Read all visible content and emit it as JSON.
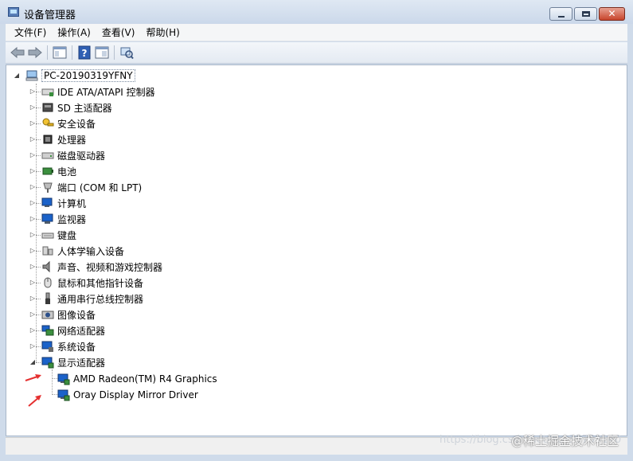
{
  "window": {
    "title": "设备管理器",
    "close_glyph": "✕"
  },
  "menu": [
    {
      "label": "文件(F)"
    },
    {
      "label": "操作(A)"
    },
    {
      "label": "查看(V)"
    },
    {
      "label": "帮助(H)"
    }
  ],
  "toolbar": {
    "icons": [
      "back-arrow-icon",
      "forward-arrow-icon",
      "properties-panel-icon",
      "help-icon",
      "show-hide-icon",
      "scan-hardware-icon"
    ]
  },
  "tree": {
    "root": {
      "label": "PC-20190319YFNY",
      "expanded": true
    },
    "categories": [
      {
        "label": "IDE ATA/ATAPI 控制器",
        "icon": "ide-controller-icon"
      },
      {
        "label": "SD 主适配器",
        "icon": "sd-adapter-icon"
      },
      {
        "label": "安全设备",
        "icon": "security-key-icon"
      },
      {
        "label": "处理器",
        "icon": "processor-icon"
      },
      {
        "label": "磁盘驱动器",
        "icon": "disk-drive-icon"
      },
      {
        "label": "电池",
        "icon": "battery-icon"
      },
      {
        "label": "端口 (COM 和 LPT)",
        "icon": "port-icon"
      },
      {
        "label": "计算机",
        "icon": "computer-icon"
      },
      {
        "label": "监视器",
        "icon": "monitor-icon"
      },
      {
        "label": "键盘",
        "icon": "keyboard-icon"
      },
      {
        "label": "人体学输入设备",
        "icon": "hid-icon"
      },
      {
        "label": "声音、视频和游戏控制器",
        "icon": "speaker-icon"
      },
      {
        "label": "鼠标和其他指针设备",
        "icon": "mouse-icon"
      },
      {
        "label": "通用串行总线控制器",
        "icon": "usb-icon"
      },
      {
        "label": "图像设备",
        "icon": "camera-icon"
      },
      {
        "label": "网络适配器",
        "icon": "network-adapter-icon"
      },
      {
        "label": "系统设备",
        "icon": "system-device-icon"
      },
      {
        "label": "显示适配器",
        "icon": "display-adapter-icon",
        "expanded": true
      }
    ],
    "display_children": [
      {
        "label": "AMD Radeon(TM) R4 Graphics"
      },
      {
        "label": "Oray Display Mirror Driver"
      }
    ]
  },
  "watermark": {
    "url": "https://blog.csdn.net/qq_35753140",
    "brand": "@稀土掘金技术社区"
  },
  "colors": {
    "title_bar": "#cbd8ea",
    "close_button": "#c7442b",
    "annotation_arrow": "#e53030"
  }
}
